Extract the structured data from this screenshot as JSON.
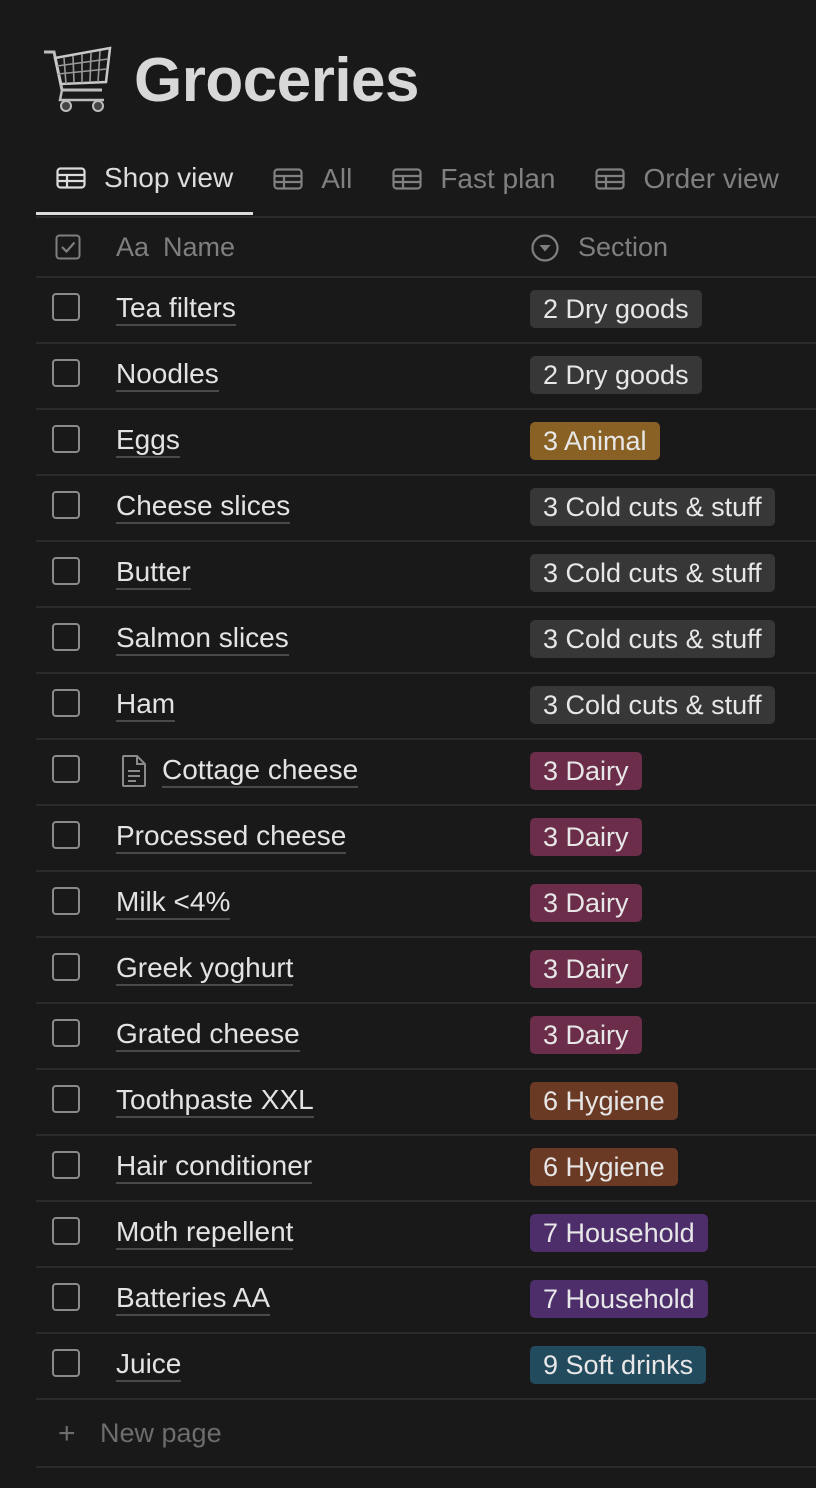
{
  "page": {
    "icon": "shopping-cart-icon",
    "title": "Groceries"
  },
  "tabs": [
    {
      "label": "Shop view",
      "icon": "table-icon",
      "active": true
    },
    {
      "label": "All",
      "icon": "table-icon",
      "active": false
    },
    {
      "label": "Fast plan",
      "icon": "table-icon",
      "active": false
    },
    {
      "label": "Order view",
      "icon": "table-icon",
      "active": false
    }
  ],
  "table": {
    "columns": {
      "checkbox_icon": "checked-checkbox-icon",
      "name_prefix": "Aa",
      "name": "Name",
      "section_icon": "select-chevron-icon",
      "section": "Section"
    },
    "rows": [
      {
        "name": "Tea filters",
        "section": "2 Dry goods",
        "color": "#373737"
      },
      {
        "name": "Noodles",
        "section": "2 Dry goods",
        "color": "#373737"
      },
      {
        "name": "Eggs",
        "section": "3 Animal",
        "color": "#8a6124"
      },
      {
        "name": "Cheese slices",
        "section": "3 Cold cuts & stuff",
        "color": "#373737"
      },
      {
        "name": "Butter",
        "section": "3 Cold cuts & stuff",
        "color": "#373737"
      },
      {
        "name": "Salmon slices",
        "section": "3 Cold cuts & stuff",
        "color": "#373737"
      },
      {
        "name": "Ham",
        "section": "3 Cold cuts & stuff",
        "color": "#373737"
      },
      {
        "name": "Cottage cheese",
        "section": "3 Dairy",
        "color": "#6b2d49",
        "page_icon": "document-icon"
      },
      {
        "name": "Processed cheese",
        "section": "3 Dairy",
        "color": "#6b2d49"
      },
      {
        "name": "Milk <4%",
        "section": "3 Dairy",
        "color": "#6b2d49"
      },
      {
        "name": "Greek yoghurt",
        "section": "3 Dairy",
        "color": "#6b2d49"
      },
      {
        "name": "Grated cheese",
        "section": "3 Dairy",
        "color": "#6b2d49"
      },
      {
        "name": "Toothpaste XXL",
        "section": "6 Hygiene",
        "color": "#6b3a25"
      },
      {
        "name": "Hair conditioner",
        "section": "6 Hygiene",
        "color": "#6b3a25"
      },
      {
        "name": "Moth repellent",
        "section": "7 Household",
        "color": "#4d2e6b"
      },
      {
        "name": "Batteries AA",
        "section": "7 Household",
        "color": "#4d2e6b"
      },
      {
        "name": "Juice",
        "section": "9 Soft drinks",
        "color": "#234b5e"
      }
    ],
    "new_page_icon": "plus-icon",
    "new_page_label": "New page"
  },
  "colors": {
    "background": "#191919",
    "divider": "#2b2b2b"
  }
}
